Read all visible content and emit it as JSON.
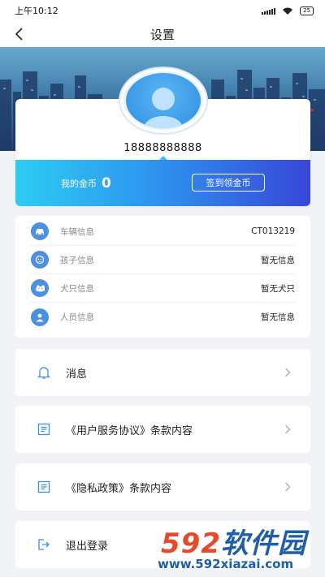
{
  "status_bar": {
    "time": "上午10:12",
    "battery": "25"
  },
  "nav": {
    "title": "设置",
    "back_icon": "chevron-left-icon"
  },
  "profile": {
    "phone": "18888888888",
    "coins_label": "我的金币",
    "coins_value": "0",
    "checkin_label": "签到领金币"
  },
  "info": {
    "items": [
      {
        "label": "车辆信息",
        "value": "CT013219",
        "icon": "car-icon"
      },
      {
        "label": "孩子信息",
        "value": "暂无信息",
        "icon": "child-icon"
      },
      {
        "label": "犬只信息",
        "value": "暂无犬只",
        "icon": "dog-icon"
      },
      {
        "label": "人员信息",
        "value": "暂无信息",
        "icon": "person-icon"
      }
    ]
  },
  "menu": {
    "items": [
      {
        "label": "消息",
        "icon": "bell-icon"
      },
      {
        "label": "《用户服务协议》条款内容",
        "icon": "document-icon"
      },
      {
        "label": "《隐私政策》条款内容",
        "icon": "document-icon"
      },
      {
        "label": "退出登录",
        "icon": "logout-icon"
      }
    ]
  },
  "watermark": {
    "brand_num": "592",
    "brand_text": "软件园",
    "url": "www.592xiazai.com"
  },
  "colors": {
    "accent": "#3c9be8",
    "coin_gradient_start": "#2ccdf3",
    "coin_gradient_end": "#3747d7",
    "watermark_blue": "#1f5fa8",
    "watermark_red": "#e6492b"
  }
}
